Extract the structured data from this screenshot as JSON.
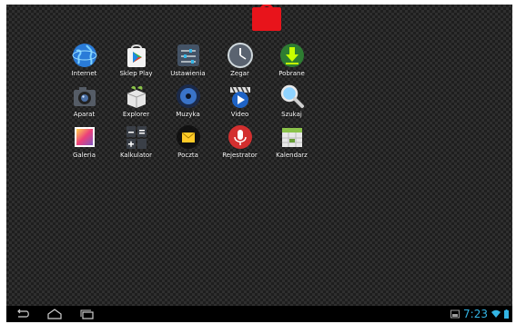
{
  "apps": [
    {
      "label": "Internet",
      "icon": "globe-icon"
    },
    {
      "label": "Sklep Play",
      "icon": "play-store-icon"
    },
    {
      "label": "Ustawienia",
      "icon": "settings-icon"
    },
    {
      "label": "Zegar",
      "icon": "clock-icon"
    },
    {
      "label": "Pobrane",
      "icon": "download-icon"
    },
    {
      "label": "Aparat",
      "icon": "camera-icon"
    },
    {
      "label": "Explorer",
      "icon": "file-explorer-icon"
    },
    {
      "label": "Muzyka",
      "icon": "music-icon"
    },
    {
      "label": "Video",
      "icon": "video-icon"
    },
    {
      "label": "Szukaj",
      "icon": "search-icon"
    },
    {
      "label": "Galeria",
      "icon": "gallery-icon"
    },
    {
      "label": "Kalkulator",
      "icon": "calculator-icon"
    },
    {
      "label": "Poczta",
      "icon": "mail-icon"
    },
    {
      "label": "Rejestrator",
      "icon": "microphone-icon"
    },
    {
      "label": "Kalendarz",
      "icon": "calendar-icon"
    }
  ],
  "status": {
    "time": "7:23",
    "accent": "#33b5e5"
  },
  "nav": {
    "back": "back-icon",
    "home": "home-icon",
    "recents": "recent-apps-icon"
  }
}
